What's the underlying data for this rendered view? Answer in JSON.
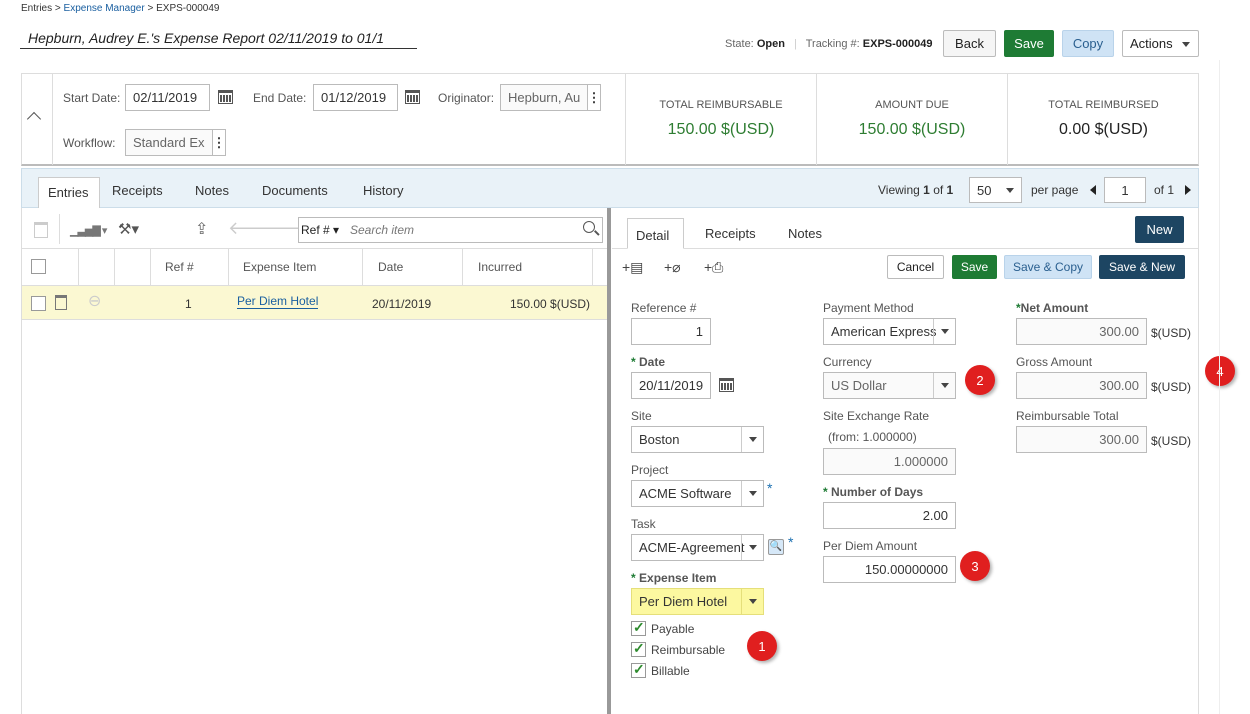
{
  "breadcrumb": {
    "root": "Entries",
    "sep1": ">",
    "link": "Expense Manager",
    "sep2": ">",
    "current": "EXPS-000049"
  },
  "title": "Hepburn, Audrey E.'s Expense Report 02/11/2019 to 01/1",
  "state": {
    "label": "State:",
    "value": "Open",
    "tracking_label": "Tracking #:",
    "tracking_value": "EXPS-000049"
  },
  "top_buttons": {
    "back": "Back",
    "save": "Save",
    "copy": "Copy",
    "actions": "Actions"
  },
  "header": {
    "start_date_label": "Start Date:",
    "start_date": "02/11/2019",
    "end_date_label": "End Date:",
    "end_date": "01/12/2019",
    "originator_label": "Originator:",
    "originator": "Hepburn, Au",
    "workflow_label": "Workflow:",
    "workflow": "Standard Ex"
  },
  "totals": [
    {
      "label": "TOTAL REIMBURSABLE",
      "value": "150.00 $(USD)",
      "color": "#2e7d32"
    },
    {
      "label": "AMOUNT DUE",
      "value": "150.00 $(USD)",
      "color": "#2e7d32"
    },
    {
      "label": "TOTAL REIMBURSED",
      "value": "0.00 $(USD)",
      "color": "#222222"
    }
  ],
  "tabs": [
    "Entries",
    "Receipts",
    "Notes",
    "Documents",
    "History"
  ],
  "pager": {
    "viewing": "Viewing",
    "from": "1",
    "of": "of",
    "total": "1",
    "page_size": "50",
    "per_page": "per page",
    "page": "1",
    "of_pages": "of 1"
  },
  "list": {
    "ref_filter": "Ref #",
    "search_placeholder": "Search item",
    "columns": [
      "Ref #",
      "Expense Item",
      "Date",
      "Incurred"
    ],
    "rows": [
      {
        "ref": "1",
        "item": "Per Diem Hotel",
        "date": "20/11/2019",
        "incurred": "150.00 $(USD)"
      }
    ]
  },
  "detail": {
    "tabs": [
      "Detail",
      "Receipts",
      "Notes"
    ],
    "new": "New",
    "buttons": {
      "cancel": "Cancel",
      "save": "Save",
      "save_copy": "Save & Copy",
      "save_new": "Save & New"
    },
    "reference_label": "Reference #",
    "reference": "1",
    "date_label": "Date",
    "date": "20/11/2019",
    "site_label": "Site",
    "site": "Boston",
    "project_label": "Project",
    "project": "ACME Software",
    "task_label": "Task",
    "task": "ACME-Agreement",
    "expense_item_label": "Expense Item",
    "expense_item": "Per Diem Hotel",
    "checks": [
      {
        "label": "Payable",
        "checked": true
      },
      {
        "label": "Reimbursable",
        "checked": true
      },
      {
        "label": "Billable",
        "checked": true
      }
    ],
    "payment_method_label": "Payment Method",
    "payment_method": "American Express",
    "currency_label": "Currency",
    "currency": "US Dollar",
    "exchange_label": "Site Exchange Rate",
    "exchange_from": "(from: 1.000000)",
    "exchange": "1.000000",
    "days_label": "Number of Days",
    "days": "2.00",
    "per_diem_label": "Per Diem Amount",
    "per_diem": "150.00000000",
    "net_label": "Net Amount",
    "net": "300.00",
    "gross_label": "Gross Amount",
    "gross": "300.00",
    "reimb_label": "Reimbursable Total",
    "reimb": "300.00",
    "unit": "$(USD)",
    "required_mark": "*"
  },
  "badges": [
    "1",
    "2",
    "3",
    "4"
  ]
}
